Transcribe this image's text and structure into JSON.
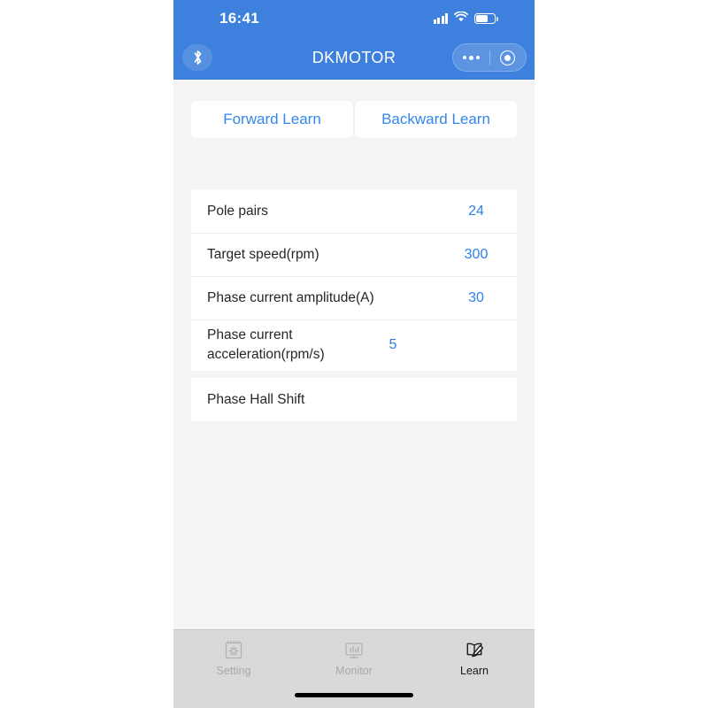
{
  "status_bar": {
    "time": "16:41",
    "signal_icon": "cellular-signal-icon",
    "wifi_icon": "wifi-icon",
    "battery_icon": "battery-icon"
  },
  "nav_bar": {
    "title": "DKMOTOR",
    "bluetooth_icon": "bluetooth-icon",
    "capsule": {
      "menu_icon": "more-dots-icon",
      "target_icon": "target-circle-icon"
    },
    "background_color": "#3d80dd"
  },
  "actions": {
    "forward_label": "Forward Learn",
    "backward_label": "Backward Learn",
    "text_color": "#3287e8"
  },
  "settings_card": {
    "rows": [
      {
        "label": "Pole pairs",
        "value": "24"
      },
      {
        "label": "Target speed(rpm)",
        "value": "300"
      },
      {
        "label": "Phase current amplitude(A)",
        "value": "30"
      },
      {
        "label": "Phase current acceleration(rpm/s)",
        "value": "5"
      }
    ],
    "value_color": "#2f7fe8"
  },
  "hall_card": {
    "rows": [
      {
        "label": "Phase Hall Shift",
        "value": ""
      }
    ]
  },
  "tab_bar": {
    "tabs": [
      {
        "label": "Setting",
        "icon": "settings-gear-note-icon",
        "active": false
      },
      {
        "label": "Monitor",
        "icon": "monitor-chart-icon",
        "active": false
      },
      {
        "label": "Learn",
        "icon": "book-pen-icon",
        "active": true
      }
    ],
    "background_color": "#d9d9d9",
    "active_color": "#1a1a1a",
    "inactive_color": "#a8a8a8"
  }
}
